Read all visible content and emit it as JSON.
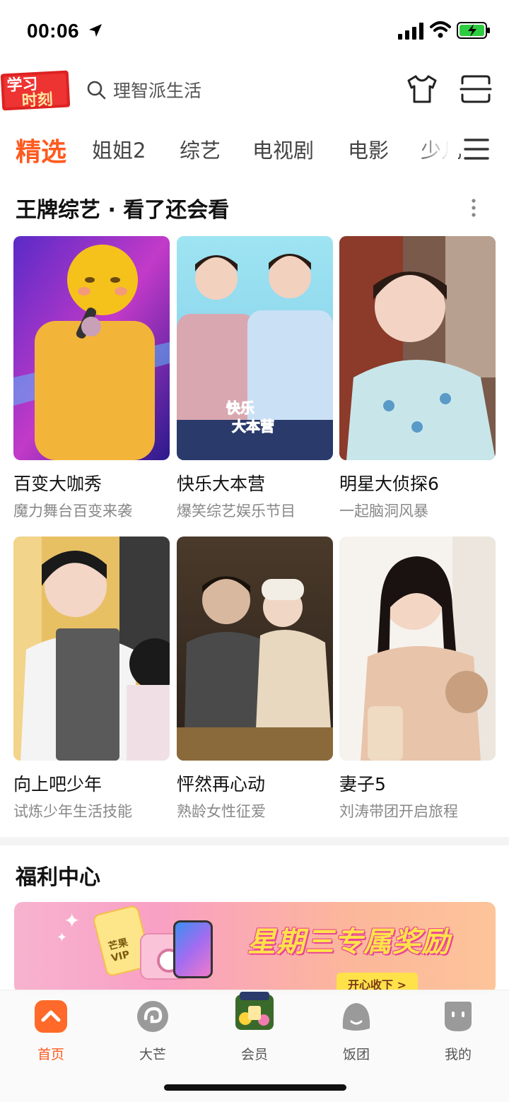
{
  "status_bar": {
    "time": "00:06"
  },
  "header": {
    "logo_text_line1": "学习",
    "logo_text_line2": "时刻",
    "search_placeholder": "理智派生活"
  },
  "tabs": [
    {
      "label": "精选",
      "active": true
    },
    {
      "label": "姐姐2",
      "active": false
    },
    {
      "label": "综艺",
      "active": false
    },
    {
      "label": "电视剧",
      "active": false
    },
    {
      "label": "电影",
      "active": false
    },
    {
      "label": "少儿",
      "active": false
    }
  ],
  "section": {
    "title": "王牌综艺 · 看了还会看",
    "cards": [
      {
        "title": "百变大咖秀",
        "subtitle": "魔力舞台百变来袭"
      },
      {
        "title": "快乐大本营",
        "subtitle": "爆笑综艺娱乐节目"
      },
      {
        "title": "明星大侦探6",
        "subtitle": "一起脑洞风暴"
      },
      {
        "title": "向上吧少年",
        "subtitle": "试炼少年生活技能"
      },
      {
        "title": "怦然再心动",
        "subtitle": "熟龄女性征爱"
      },
      {
        "title": "妻子5",
        "subtitle": "刘涛带团开启旅程"
      }
    ]
  },
  "welfare": {
    "title": "福利中心",
    "banner_text": "星期三专属奖励",
    "banner_button": "开心收下 >",
    "banner_card_text": "芒果VIP"
  },
  "bottom_nav": [
    {
      "label": "首页",
      "active": true
    },
    {
      "label": "大芒",
      "active": false
    },
    {
      "label": "会员",
      "active": false
    },
    {
      "label": "饭团",
      "active": false
    },
    {
      "label": "我的",
      "active": false
    }
  ],
  "colors": {
    "accent": "#ff5a1f",
    "nav_inactive": "#9a9a9a"
  }
}
